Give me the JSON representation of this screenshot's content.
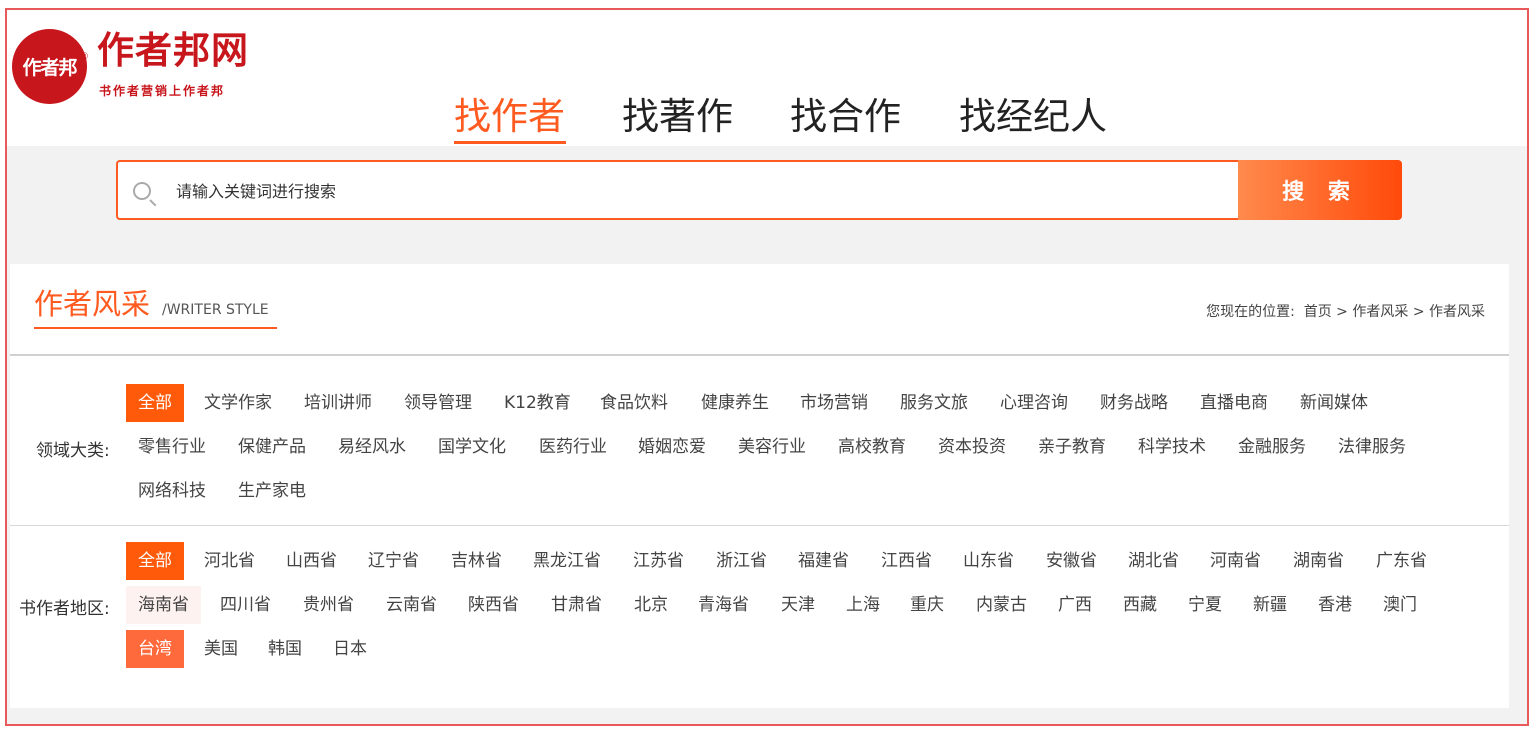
{
  "logo": {
    "circle_text": "作者邦",
    "reg_mark": "®",
    "title": "作者邦网",
    "subtitle": "书作者营销上作者邦"
  },
  "nav": {
    "tabs": [
      "找作者",
      "找著作",
      "找合作",
      "找经纪人"
    ],
    "active": 0
  },
  "search": {
    "placeholder": "请输入关键词进行搜索",
    "button_label": "搜 索"
  },
  "section": {
    "title": "作者风采",
    "subtitle_en": "/WRITER STYLE",
    "breadcrumb": {
      "prefix": "您现在的位置:",
      "items": [
        "首页",
        "作者风采",
        "作者风采"
      ],
      "separator": ">"
    }
  },
  "filters": {
    "field": {
      "label": "领域大类:",
      "rows": [
        [
          "全部",
          "文学作家",
          "培训讲师",
          "领导管理",
          "K12教育",
          "食品饮料",
          "健康养生",
          "市场营销",
          "服务文旅",
          "心理咨询",
          "财务战略",
          "直播电商",
          "新闻媒体"
        ],
        [
          "零售行业",
          "保健产品",
          "易经风水",
          "国学文化",
          "医药行业",
          "婚姻恋爱",
          "美容行业",
          "高校教育",
          "资本投资",
          "亲子教育",
          "科学技术",
          "金融服务",
          "法律服务"
        ],
        [
          "网络科技",
          "生产家电"
        ]
      ],
      "selected": "全部"
    },
    "region": {
      "label": "书作者地区:",
      "rows": [
        [
          "全部",
          "河北省",
          "山西省",
          "辽宁省",
          "吉林省",
          "黑龙江省",
          "江苏省",
          "浙江省",
          "福建省",
          "江西省",
          "山东省",
          "安徽省",
          "湖北省",
          "河南省",
          "湖南省",
          "广东省"
        ],
        [
          "海南省",
          "四川省",
          "贵州省",
          "云南省",
          "陕西省",
          "甘肃省",
          "北京",
          "青海省",
          "天津",
          "上海",
          "重庆",
          "内蒙古",
          "广西",
          "西藏",
          "宁夏",
          "新疆",
          "香港",
          "澳门"
        ],
        [
          "台湾",
          "美国",
          "韩国",
          "日本"
        ]
      ],
      "selected": "全部",
      "hovered": "台湾",
      "light_hover": "海南省"
    }
  },
  "colors": {
    "accent": "#ff5a1f",
    "brand_red": "#c8161d",
    "frame": "#e8595b"
  }
}
